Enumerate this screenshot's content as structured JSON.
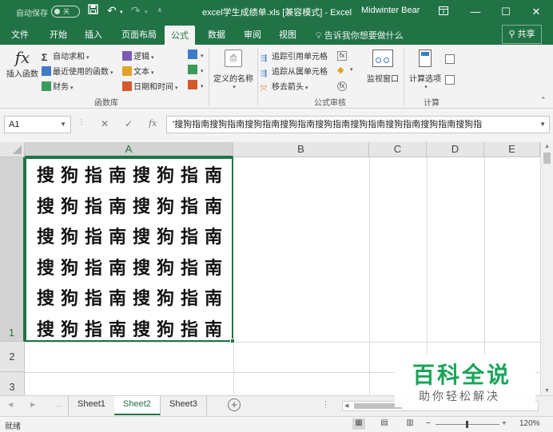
{
  "titlebar": {
    "autosave_label": "自动保存",
    "autosave_state": "关",
    "title": "excel学生成绩单.xls  [兼容模式]  -  Excel",
    "user": "Midwinter Bear"
  },
  "tabs": [
    "文件",
    "开始",
    "插入",
    "页面布局",
    "公式",
    "数据",
    "审阅",
    "视图"
  ],
  "active_tab": "公式",
  "tell_me": "告诉我你想要做什么",
  "share": "共享",
  "ribbon": {
    "insert_function": "插入函数",
    "autosum": "自动求和",
    "recent": "最近使用的函数",
    "financial": "财务",
    "logical": "逻辑",
    "text": "文本",
    "datetime": "日期和时间",
    "defined_names": "定义的名称",
    "trace_precedents": "追踪引用单元格",
    "trace_dependents": "追踪从属单元格",
    "remove_arrows": "移去箭头",
    "watch_window": "监视窗口",
    "calc_options": "计算选项",
    "group_function_library": "函数库",
    "group_formula_auditing": "公式审核",
    "group_calculation": "计算"
  },
  "namebox": "A1",
  "formula": "'搜狗指南搜狗指南搜狗指南搜狗指南搜狗指南搜狗指南搜狗指南搜狗指南搜狗指",
  "columns": [
    "A",
    "B",
    "C",
    "D",
    "E"
  ],
  "rows": [
    "1",
    "2",
    "3"
  ],
  "cell_a1_lines": [
    "搜狗指南搜狗指南",
    "搜狗指南搜狗指南",
    "搜狗指南搜狗指南",
    "搜狗指南搜狗指南",
    "搜狗指南搜狗指南",
    "搜狗指南搜狗指南"
  ],
  "sheets": [
    "Sheet1",
    "Sheet2",
    "Sheet3"
  ],
  "active_sheet": "Sheet2",
  "status": {
    "ready": "就绪",
    "zoom": "120%"
  },
  "watermark": {
    "brand": "百科全说",
    "slogan": "助你轻松解决"
  },
  "colors": {
    "excel_green": "#217346",
    "watermark_green": "#1aa45a"
  }
}
